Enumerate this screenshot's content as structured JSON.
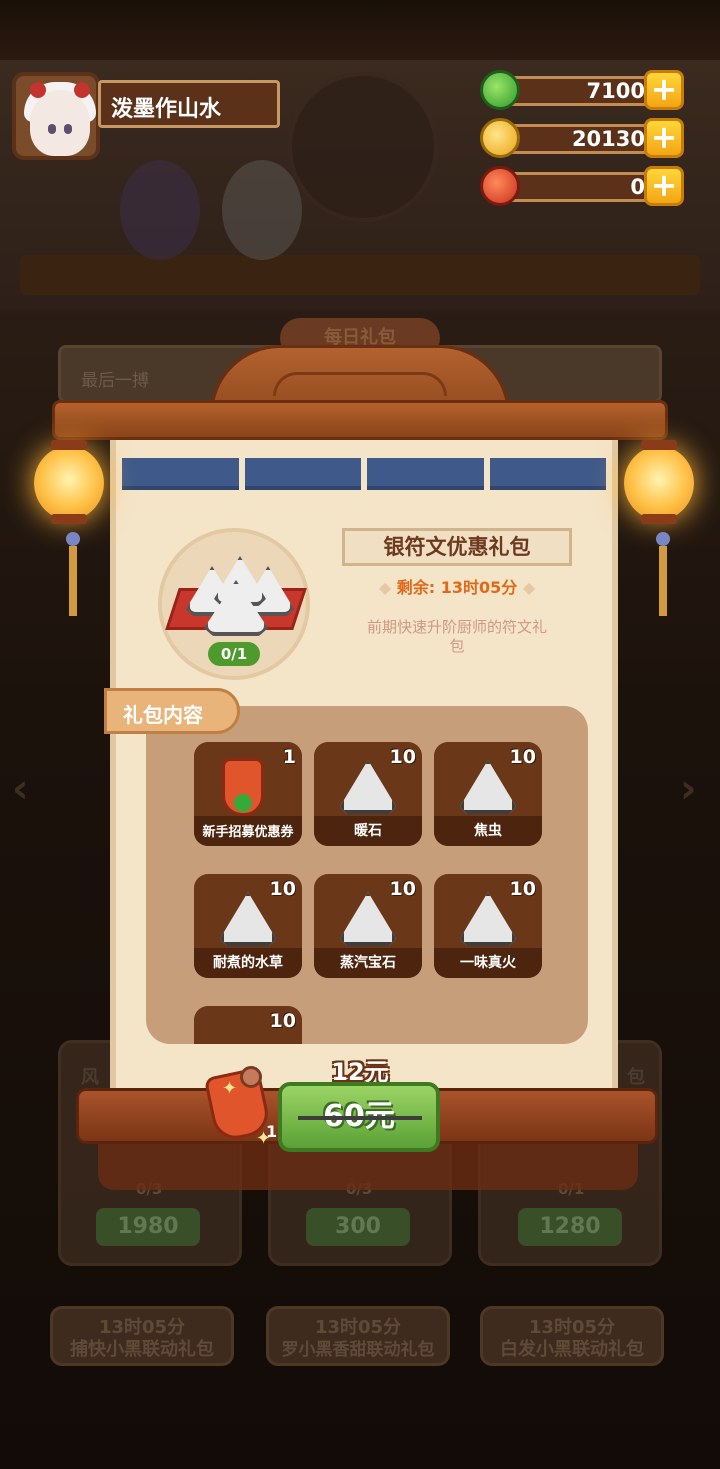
{
  "player": {
    "name": "泼墨作山水"
  },
  "currencies": [
    {
      "icon": "green-jade-icon",
      "value": "7100",
      "color": "#3fae3a"
    },
    {
      "icon": "gold-coin-icon",
      "value": "20130",
      "color": "#f2b41c"
    },
    {
      "icon": "red-gem-icon",
      "value": "0",
      "color": "#d9361f"
    }
  ],
  "background": {
    "daily_tab": "每日礼包",
    "banner_text": "最后一搏",
    "card_progress": [
      "0/3",
      "0/3",
      "0/1"
    ],
    "card_prices": [
      "1980",
      "300",
      "1280"
    ],
    "card_labels_left": "风",
    "card_labels_right": "包",
    "bottom_timers": [
      "13时05分",
      "13时05分",
      "13时05分"
    ],
    "bottom_names": [
      "捕快小黑联动礼包",
      "罗小黑香甜联动礼包",
      "白发小黑联动礼包"
    ]
  },
  "pack": {
    "title": "银符文优惠礼包",
    "remaining": "剩余: 13时05分",
    "description": "前期快速升阶厨师的符文礼包",
    "count": "0/1",
    "contents_label": "礼包内容"
  },
  "items": [
    {
      "label": "新手招募优惠券",
      "qty": "1",
      "icon": "recruit-coupon-icon"
    },
    {
      "label": "暖石",
      "qty": "10",
      "icon": "warm-stone-rune-icon"
    },
    {
      "label": "焦虫",
      "qty": "10",
      "icon": "burnt-bug-rune-icon"
    },
    {
      "label": "耐煮的水草",
      "qty": "10",
      "icon": "waterweed-rune-icon"
    },
    {
      "label": "蒸汽宝石",
      "qty": "10",
      "icon": "steam-gem-rune-icon"
    },
    {
      "label": "一味真火",
      "qty": "10",
      "icon": "true-fire-rune-icon"
    },
    {
      "label": "",
      "qty": "10",
      "icon": "rune-icon"
    }
  ],
  "purchase": {
    "new_price": "12元",
    "old_price": "60元",
    "coupon_qty": "1"
  }
}
